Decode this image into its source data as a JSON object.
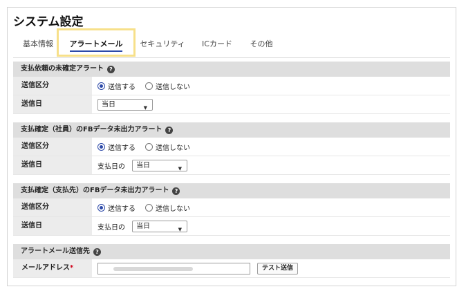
{
  "page": {
    "title": "システム設定"
  },
  "tabs": [
    {
      "label": "基本情報",
      "active": false
    },
    {
      "label": "アラートメール",
      "active": true
    },
    {
      "label": "セキュリティ",
      "active": false
    },
    {
      "label": "ICカード",
      "active": false
    },
    {
      "label": "その他",
      "active": false
    }
  ],
  "sections": [
    {
      "title": "支払依頼の未確定アラート",
      "send_label": "送信区分",
      "send_yes": "送信する",
      "send_no": "送信しない",
      "date_label": "送信日",
      "date_value": "当日"
    },
    {
      "title": "支払確定（社員）のFBデータ未出力アラート",
      "send_label": "送信区分",
      "send_yes": "送信する",
      "send_no": "送信しない",
      "date_label": "送信日",
      "date_prefix": "支払日の",
      "date_value": "当日"
    },
    {
      "title": "支払確定（支払先）のFBデータ未出力アラート",
      "send_label": "送信区分",
      "send_yes": "送信する",
      "send_no": "送信しない",
      "date_label": "送信日",
      "date_prefix": "支払日の",
      "date_value": "当日"
    }
  ],
  "mail_section": {
    "title": "アラートメール送信先",
    "address_label": "メールアドレス",
    "required_mark": "*",
    "test_button": "テスト送信"
  },
  "help_icon": "?",
  "caret_icon": "▼",
  "colors": {
    "accent": "#2c49a8",
    "header_bg": "#dedede",
    "label_bg": "#ececec",
    "highlight": "#f7e08a",
    "required": "#d0021b"
  }
}
